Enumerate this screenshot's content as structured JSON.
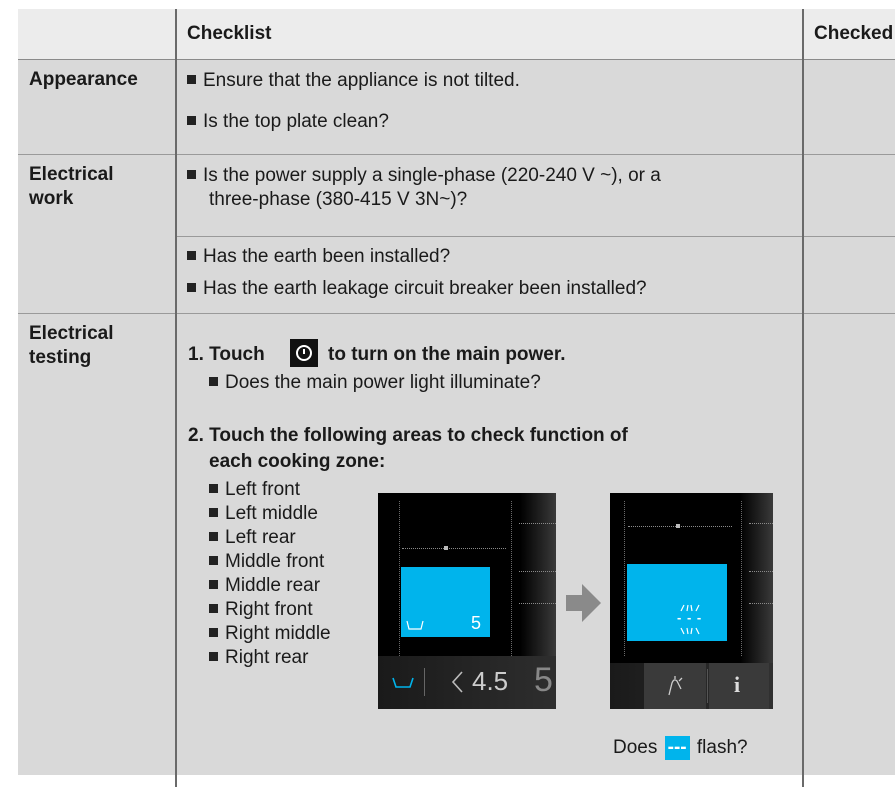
{
  "header": {
    "checklist": "Checklist",
    "checked": "Checked"
  },
  "rows": {
    "appearance": {
      "label": "Appearance",
      "items": [
        "Ensure that the appliance is not tilted.",
        "Is the top plate clean?"
      ]
    },
    "electrical_work": {
      "label_line1": "Electrical",
      "label_line2": "work",
      "power_line1": "Is the power supply a single-phase (220-240 V ~), or a",
      "power_line2": "three-phase (380-415 V 3N~)?",
      "items": [
        "Has the earth been installed?",
        "Has the earth leakage circuit breaker been installed?"
      ]
    },
    "electrical_testing": {
      "label_line1": "Electrical",
      "label_line2": "testing",
      "step1_num": "1.",
      "step1_pre": "Touch",
      "step1_post": "to turn on the main power.",
      "step1_q": "Does the main power light illuminate?",
      "step2_num": "2.",
      "step2_line1": "Touch the following areas to check function of",
      "step2_line2": "each cooking zone:",
      "zones": [
        "Left front",
        "Left middle",
        "Left rear",
        "Middle front",
        "Middle rear",
        "Right front",
        "Right middle",
        "Right rear"
      ],
      "flash_pre": "Does",
      "flash_symbol": "---",
      "flash_post": "flash?"
    }
  },
  "display": {
    "level_before": "5",
    "slider_value": "4.5",
    "slider_next": "5",
    "info_label": "i",
    "flashing_dashes": "- - -"
  },
  "colors": {
    "accent": "#00b4ec",
    "row_bg": "#d9d9d9",
    "header_bg": "#ececec"
  },
  "icons": [
    "power-icon",
    "pot-icon",
    "chevron-left-icon",
    "arrow-right-icon",
    "wipe-protection-icon",
    "info-icon"
  ]
}
